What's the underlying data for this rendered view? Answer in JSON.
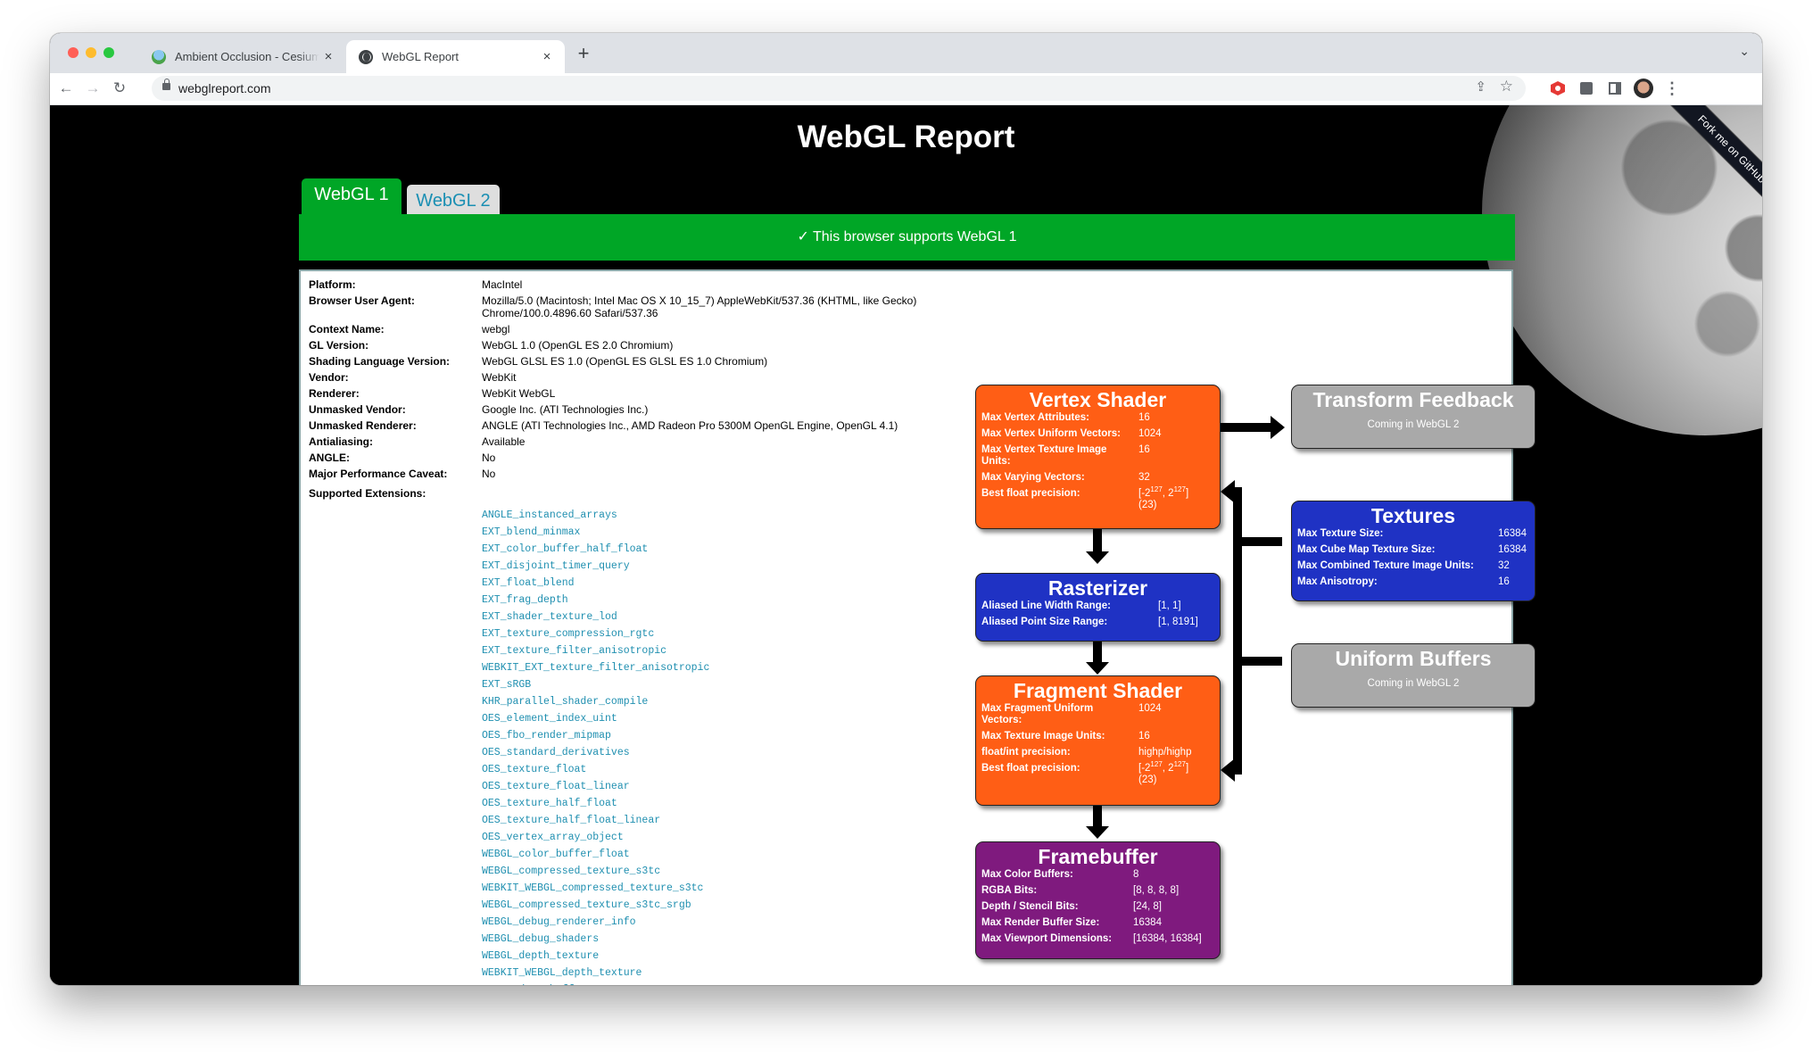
{
  "browser": {
    "tabs": [
      {
        "title": "Ambient Occlusion - Cesium Sandcastle",
        "active": false
      },
      {
        "title": "WebGL Report",
        "active": true
      }
    ],
    "new_tab_label": "+",
    "url": "webglreport.com",
    "icons": {
      "back": "←",
      "forward": "→",
      "reload": "↻",
      "share": "⇪",
      "bookmark": "☆",
      "menu": "⋮",
      "tab_search": "⌄",
      "close": "×"
    }
  },
  "page": {
    "title": "WebGL Report",
    "ribbon": "Fork me on GitHub",
    "api_tabs": [
      {
        "label": "WebGL 1",
        "active": true
      },
      {
        "label": "WebGL 2",
        "active": false
      }
    ],
    "banner": "✓ This browser supports WebGL 1",
    "info": [
      {
        "label": "Platform:",
        "value": "MacIntel"
      },
      {
        "label": "Browser User Agent:",
        "value": "Mozilla/5.0 (Macintosh; Intel Mac OS X 10_15_7) AppleWebKit/537.36 (KHTML, like Gecko) Chrome/100.0.4896.60 Safari/537.36"
      },
      {
        "label": "Context Name:",
        "value": "webgl"
      },
      {
        "label": "GL Version:",
        "value": "WebGL 1.0 (OpenGL ES 2.0 Chromium)"
      },
      {
        "label": "Shading Language Version:",
        "value": "WebGL GLSL ES 1.0 (OpenGL ES GLSL ES 1.0 Chromium)"
      },
      {
        "label": "Vendor:",
        "value": "WebKit"
      },
      {
        "label": "Renderer:",
        "value": "WebKit WebGL"
      },
      {
        "label": "Unmasked Vendor:",
        "value": "Google Inc. (ATI Technologies Inc.)"
      },
      {
        "label": "Unmasked Renderer:",
        "value": "ANGLE (ATI Technologies Inc., AMD Radeon Pro 5300M OpenGL Engine, OpenGL 4.1)"
      },
      {
        "label": "Antialiasing:",
        "value": "Available"
      },
      {
        "label": "ANGLE:",
        "value": "No"
      },
      {
        "label": "Major Performance Caveat:",
        "value": "No"
      },
      {
        "label": "Supported Extensions:",
        "value": ""
      }
    ],
    "extensions": [
      "ANGLE_instanced_arrays",
      "EXT_blend_minmax",
      "EXT_color_buffer_half_float",
      "EXT_disjoint_timer_query",
      "EXT_float_blend",
      "EXT_frag_depth",
      "EXT_shader_texture_lod",
      "EXT_texture_compression_rgtc",
      "EXT_texture_filter_anisotropic",
      "WEBKIT_EXT_texture_filter_anisotropic",
      "EXT_sRGB",
      "KHR_parallel_shader_compile",
      "OES_element_index_uint",
      "OES_fbo_render_mipmap",
      "OES_standard_derivatives",
      "OES_texture_float",
      "OES_texture_float_linear",
      "OES_texture_half_float",
      "OES_texture_half_float_linear",
      "OES_vertex_array_object",
      "WEBGL_color_buffer_float",
      "WEBGL_compressed_texture_s3tc",
      "WEBKIT_WEBGL_compressed_texture_s3tc",
      "WEBGL_compressed_texture_s3tc_srgb",
      "WEBGL_debug_renderer_info",
      "WEBGL_debug_shaders",
      "WEBGL_depth_texture",
      "WEBKIT_WEBGL_depth_texture",
      "WEBGL_draw_buffers"
    ],
    "pipeline": {
      "vertex_shader": {
        "title": "Vertex Shader",
        "rows": [
          {
            "label": "Max Vertex Attributes:",
            "value": "16"
          },
          {
            "label": "Max Vertex Uniform Vectors:",
            "value": "1024"
          },
          {
            "label": "Max Vertex Texture Image Units:",
            "value": "16"
          },
          {
            "label": "Max Varying Vectors:",
            "value": "32"
          },
          {
            "label": "Best float precision:",
            "value": "[-2^127, 2^127] (23)"
          }
        ]
      },
      "rasterizer": {
        "title": "Rasterizer",
        "rows": [
          {
            "label": "Aliased Line Width Range:",
            "value": "[1, 1]"
          },
          {
            "label": "Aliased Point Size Range:",
            "value": "[1, 8191]"
          }
        ]
      },
      "fragment_shader": {
        "title": "Fragment Shader",
        "rows": [
          {
            "label": "Max Fragment Uniform Vectors:",
            "value": "1024"
          },
          {
            "label": "Max Texture Image Units:",
            "value": "16"
          },
          {
            "label": "float/int precision:",
            "value": "highp/highp"
          },
          {
            "label": "Best float precision:",
            "value": "[-2^127, 2^127] (23)"
          }
        ]
      },
      "framebuffer": {
        "title": "Framebuffer",
        "rows": [
          {
            "label": "Max Color Buffers:",
            "value": "8"
          },
          {
            "label": "RGBA Bits:",
            "value": "[8, 8, 8, 8]"
          },
          {
            "label": "Depth / Stencil Bits:",
            "value": "[24, 8]"
          },
          {
            "label": "Max Render Buffer Size:",
            "value": "16384"
          },
          {
            "label": "Max Viewport Dimensions:",
            "value": "[16384, 16384]"
          }
        ]
      },
      "transform_feedback": {
        "title": "Transform Feedback",
        "note": "Coming in WebGL 2"
      },
      "textures": {
        "title": "Textures",
        "rows": [
          {
            "label": "Max Texture Size:",
            "value": "16384"
          },
          {
            "label": "Max Cube Map Texture Size:",
            "value": "16384"
          },
          {
            "label": "Max Combined Texture Image Units:",
            "value": "32"
          },
          {
            "label": "Max Anisotropy:",
            "value": "16"
          }
        ]
      },
      "uniform_buffers": {
        "title": "Uniform Buffers",
        "note": "Coming in WebGL 2"
      }
    },
    "colors": {
      "banner_green": "#00a626",
      "vertex_fragment_orange": "#ff5e15",
      "rasterizer_textures_blue": "#1f32c4",
      "framebuffer_purple": "#7f1a7e",
      "unavailable_gray": "#a9a9a9",
      "extension_link": "#1f8fb0"
    }
  }
}
